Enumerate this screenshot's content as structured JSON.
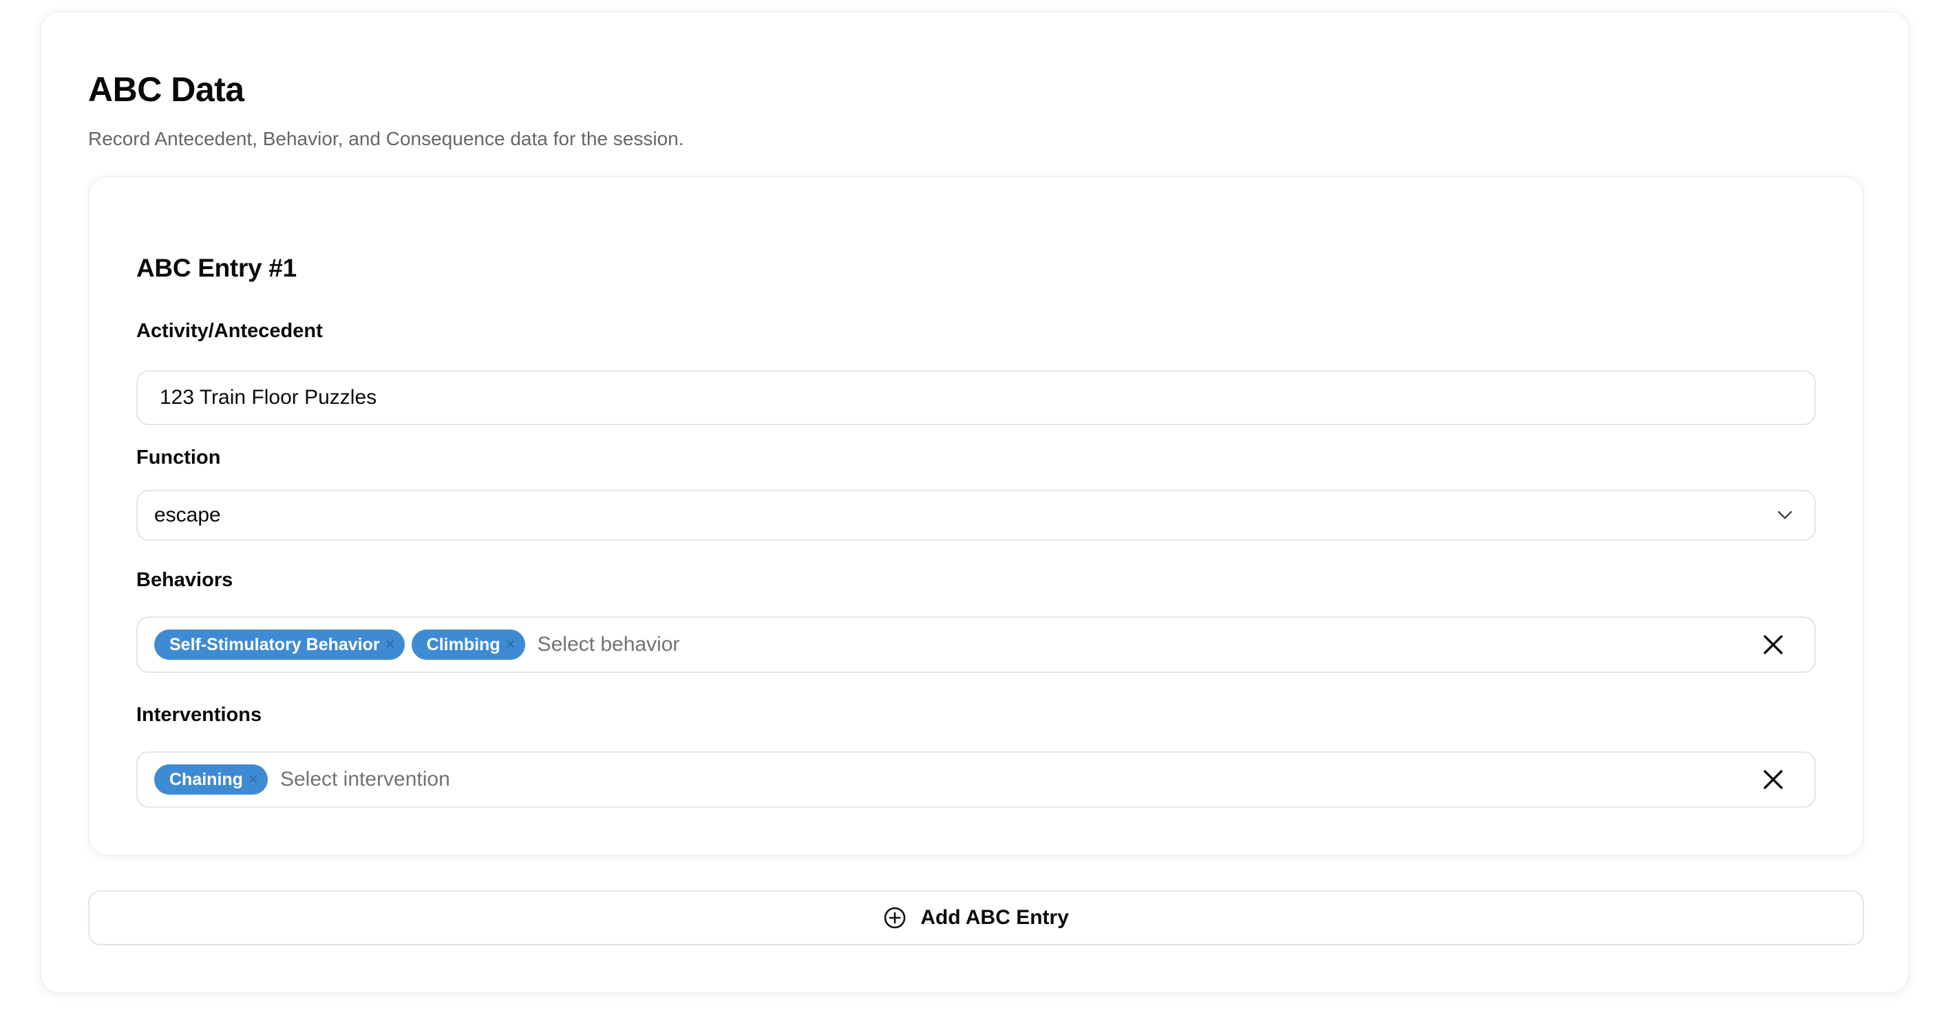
{
  "section": {
    "title": "ABC Data",
    "subtitle": "Record Antecedent, Behavior, and Consequence data for the session."
  },
  "entry": {
    "title": "ABC Entry #1",
    "activity": {
      "label": "Activity/Antecedent",
      "value": "123 Train Floor Puzzles"
    },
    "function": {
      "label": "Function",
      "value": "escape",
      "icon": "chevron-down-icon"
    },
    "behaviors": {
      "label": "Behaviors",
      "tags": [
        "Self-Stimulatory Behavior",
        "Climbing"
      ],
      "placeholder": "Select behavior",
      "clear_icon": "close-icon"
    },
    "interventions": {
      "label": "Interventions",
      "tags": [
        "Chaining"
      ],
      "placeholder": "Select intervention",
      "clear_icon": "close-icon"
    }
  },
  "add_button": {
    "label": "Add ABC Entry",
    "icon": "plus-circle-icon"
  },
  "colors": {
    "tag_bg": "#3f8bd3",
    "tag_text": "#ffffff",
    "text_primary": "#0a0a0a",
    "text_muted": "#666666",
    "border": "#e5e5e5"
  }
}
